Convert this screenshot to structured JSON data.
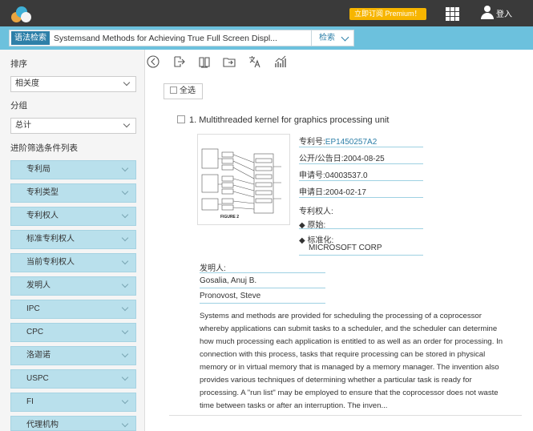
{
  "header": {
    "premium_label": "立即订阅 Premium！",
    "login_label": "登入"
  },
  "search": {
    "mode_tag": "语法检索",
    "query": "Systemsand Methods for Achieving True Full Screen Displ...",
    "button_label": "检索"
  },
  "sidebar": {
    "sort_label": "排序",
    "sort_value": "相关度",
    "group_label": "分组",
    "group_value": "总计",
    "filter_label": "进阶筛选条件列表",
    "facets": [
      "专利局",
      "专利类型",
      "专利权人",
      "标准专利权人",
      "当前专利权人",
      "发明人",
      "IPC",
      "CPC",
      "洛迦诺",
      "USPC",
      "FI",
      "代理机构"
    ]
  },
  "results": {
    "select_all_label": "全选",
    "item": {
      "title": "1. Multithreaded kernel for graphics processing unit",
      "figure_caption": "FIGURE 2",
      "patent_no_label": "专利号:",
      "patent_no": "EP1450257A2",
      "pub_date": "公开/公告日:2004-08-25",
      "app_no": "申请号:04003537.0",
      "app_date": "申请日:2004-02-17",
      "assignee_label": "专利权人:",
      "original_label": "原始:",
      "standard_label": "标准化:",
      "assignee": "MICROSOFT CORP",
      "inventor_label": "发明人:",
      "inventors": [
        "Gosalia, Anuj B.",
        "Pronovost, Steve"
      ],
      "abstract": "Systems and methods are provided for scheduling the processing of a coprocessor whereby applications can submit tasks to a scheduler, and the scheduler can determine how much processing each application is entitled to as well as an order for processing. In connection with this process, tasks that require processing can be stored in physical memory or in virtual memory that is managed by a memory manager. The invention also provides various techniques of determining whether a particular task is ready for processing. A \"run list\" may be employed to ensure that the coprocessor does not waste time between tasks or after an interruption. The inven..."
    }
  },
  "colors": {
    "header_bg": "#3a3a3a",
    "search_band": "#6cc1dd",
    "premium": "#f7b500",
    "facet_bg": "#b9e0ec",
    "link": "#2d7fa8"
  }
}
